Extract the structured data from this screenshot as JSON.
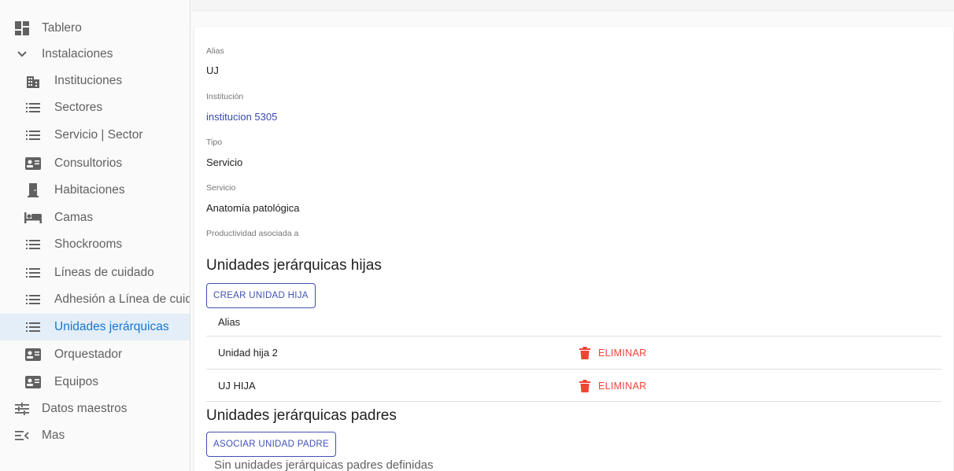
{
  "sidebar": {
    "items": [
      {
        "label": "Tablero",
        "icon": "dashboard-icon",
        "level": "top"
      },
      {
        "label": "Instalaciones",
        "icon": "chevron-down-icon",
        "level": "top"
      },
      {
        "label": "Instituciones",
        "icon": "domain-icon",
        "level": "sub"
      },
      {
        "label": "Sectores",
        "icon": "list-icon",
        "level": "sub"
      },
      {
        "label": "Servicio | Sector",
        "icon": "list-icon",
        "level": "sub"
      },
      {
        "label": "Consultorios",
        "icon": "contact-card-icon",
        "level": "sub"
      },
      {
        "label": "Habitaciones",
        "icon": "door-icon",
        "level": "sub"
      },
      {
        "label": "Camas",
        "icon": "bed-icon",
        "level": "sub"
      },
      {
        "label": "Shockrooms",
        "icon": "list-icon",
        "level": "sub"
      },
      {
        "label": "Líneas de cuidado",
        "icon": "list-icon",
        "level": "sub"
      },
      {
        "label": "Adhesión a Línea de cuid",
        "icon": "list-icon",
        "level": "sub"
      },
      {
        "label": "Unidades jerárquicas",
        "icon": "list-icon",
        "level": "sub",
        "active": true
      },
      {
        "label": "Orquestador",
        "icon": "contact-card-icon",
        "level": "sub"
      },
      {
        "label": "Equipos",
        "icon": "contact-card-icon",
        "level": "sub"
      },
      {
        "label": "Datos maestros",
        "icon": "tune-icon",
        "level": "top"
      },
      {
        "label": "Mas",
        "icon": "menu-open-icon",
        "level": "top"
      }
    ]
  },
  "detail": {
    "alias_label": "Alias",
    "alias_value": "UJ",
    "institution_label": "Institución",
    "institution_value": "institucion 5305",
    "type_label": "Tipo",
    "type_value": "Servicio",
    "service_label": "Servicio",
    "service_value": "Anatomía patológica",
    "productivity_label": "Productividad asociada a"
  },
  "children": {
    "title": "Unidades jerárquicas hijas",
    "create_button": "CREAR UNIDAD HIJA",
    "column_alias": "Alias",
    "rows": [
      {
        "alias": "Unidad hija 2",
        "delete_label": "ELIMINAR"
      },
      {
        "alias": "UJ HIJA",
        "delete_label": "ELIMINAR"
      }
    ]
  },
  "parents": {
    "title": "Unidades jerárquicas padres",
    "associate_button": "ASOCIAR UNIDAD PADRE",
    "empty_text": "Sin unidades jerárquicas padres definidas"
  },
  "colors": {
    "active_text": "#1976d2",
    "active_bg": "#e3eef8",
    "primary": "#3f51b5",
    "delete": "#f44336"
  }
}
